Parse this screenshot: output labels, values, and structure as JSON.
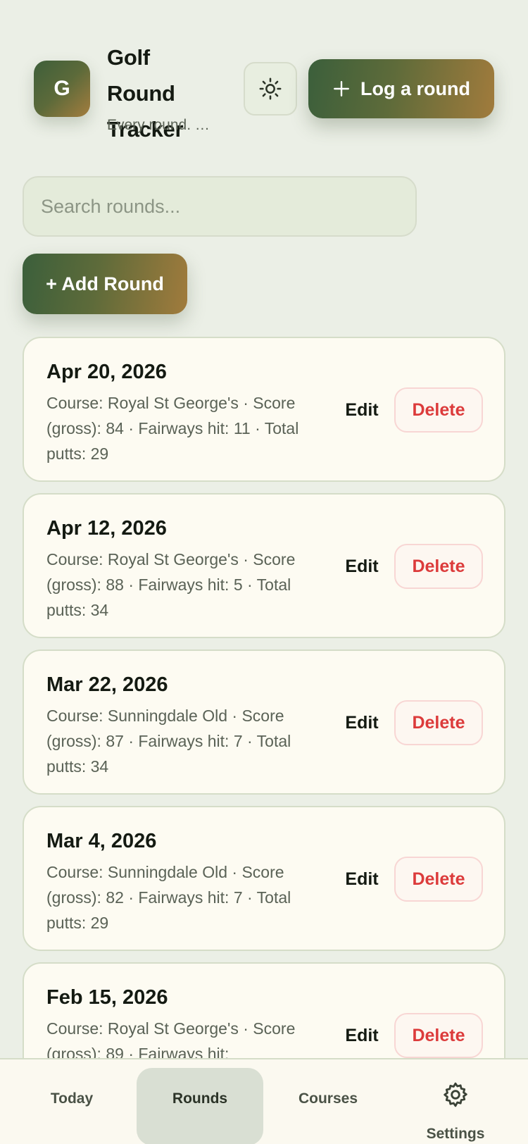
{
  "header": {
    "logo_letter": "G",
    "title_lines": [
      "Golf",
      "Round",
      "Tracker"
    ],
    "tagline": "Every round. …",
    "theme_toggle_icon": "sun-icon",
    "log_round_label": "Log a round"
  },
  "search": {
    "placeholder": "Search rounds..."
  },
  "add_round_label": "+ Add Round",
  "rounds": [
    {
      "date": "Apr 20, 2026",
      "details": "Course: Royal St George's · Score (gross): 84 · Fairways hit: 11 · Total putts: 29",
      "edit": "Edit",
      "delete": "Delete"
    },
    {
      "date": "Apr 12, 2026",
      "details": "Course: Royal St George's · Score (gross): 88 · Fairways hit: 5 · Total putts: 34",
      "edit": "Edit",
      "delete": "Delete"
    },
    {
      "date": "Mar 22, 2026",
      "details": "Course: Sunningdale Old · Score (gross): 87 · Fairways hit: 7 · Total putts: 34",
      "edit": "Edit",
      "delete": "Delete"
    },
    {
      "date": "Mar 4, 2026",
      "details": "Course: Sunningdale Old · Score (gross): 82 · Fairways hit: 7 · Total putts: 29",
      "edit": "Edit",
      "delete": "Delete"
    },
    {
      "date": "Feb 15, 2026",
      "details": "Course: Royal St George's · Score (gross): 89 · Fairways hit:",
      "edit": "Edit",
      "delete": "Delete"
    }
  ],
  "nav": {
    "today": "Today",
    "rounds": "Rounds",
    "courses": "Courses",
    "settings": "Settings",
    "active": "rounds"
  },
  "colors": {
    "background": "#ebefe6",
    "accent_start": "#3b5f3b",
    "accent_end": "#a17b3c",
    "delete": "#dc3b3b"
  }
}
